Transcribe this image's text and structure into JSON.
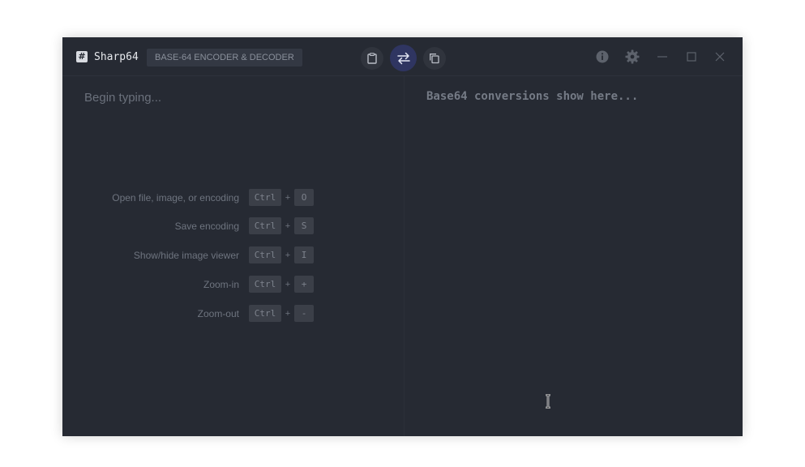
{
  "app": {
    "name": "Sharp64",
    "logo_glyph": "#",
    "subtitle": "BASE-64 ENCODER & DECODER"
  },
  "toolbar": {
    "center_icons": [
      "clipboard-icon",
      "swap-arrows-icon",
      "copy-icon"
    ],
    "right_icons": [
      "info-icon",
      "gear-icon",
      "minimize-icon",
      "maximize-icon",
      "close-icon"
    ],
    "active_color": "#2f3561"
  },
  "input": {
    "placeholder": "Begin typing..."
  },
  "output": {
    "placeholder": "Base64 conversions show here..."
  },
  "shortcuts": [
    {
      "label": "Open file, image, or encoding",
      "modifier": "Ctrl",
      "plus": "+",
      "key": "O"
    },
    {
      "label": "Save encoding",
      "modifier": "Ctrl",
      "plus": "+",
      "key": "S"
    },
    {
      "label": "Show/hide image viewer",
      "modifier": "Ctrl",
      "plus": "+",
      "key": "I"
    },
    {
      "label": "Zoom-in",
      "modifier": "Ctrl",
      "plus": "+",
      "key": "+"
    },
    {
      "label": "Zoom-out",
      "modifier": "Ctrl",
      "plus": "+",
      "key": "-"
    }
  ],
  "colors": {
    "window_bg": "#262a33",
    "text_dim": "#6e747f",
    "key_bg": "#3b3f48"
  }
}
